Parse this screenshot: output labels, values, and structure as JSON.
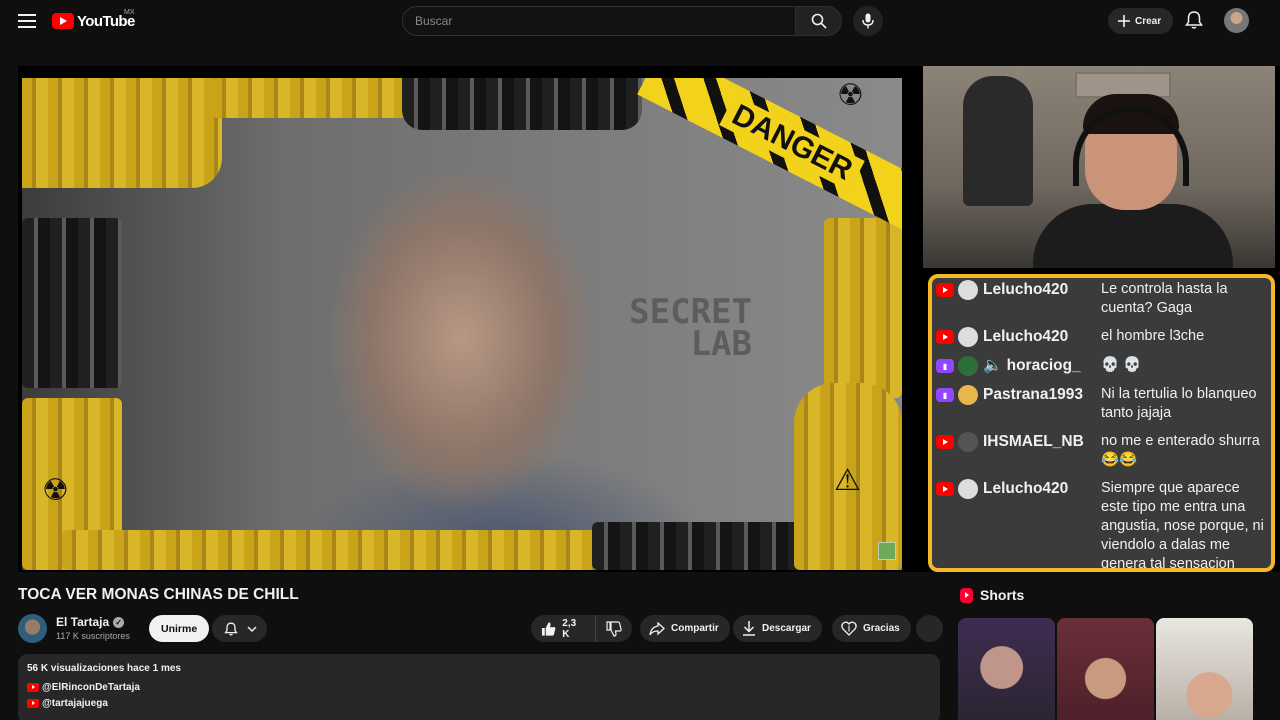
{
  "header": {
    "logo_text": "YouTube",
    "country": "MX",
    "search_placeholder": "Buscar",
    "create_label": "Crear"
  },
  "video": {
    "overlay_tape_text": "DANGER",
    "wall_text_line1": "SECRET",
    "wall_text_line2": "LAB",
    "title": "TOCA VER MONAS CHINAS DE CHILL"
  },
  "chat": {
    "messages": [
      {
        "platform": "youtube",
        "user": "Lelucho420",
        "text": "Le controla hasta la cuenta? Gaga"
      },
      {
        "platform": "youtube",
        "user": "Lelucho420",
        "text": "el hombre l3che"
      },
      {
        "platform": "twitch",
        "user": "🔈 horaciog_",
        "text": "💀 💀"
      },
      {
        "platform": "twitch",
        "user": "Pastrana1993",
        "text": "Ni la tertulia lo blanqueo tanto jajaja"
      },
      {
        "platform": "youtube",
        "user": "IHSMAEL_NB",
        "text": "no me e enterado shurra 😂😂"
      },
      {
        "platform": "youtube",
        "user": "Lelucho420",
        "text": "Siempre que aparece este tipo me entra una angustia, nose porque, ni viendolo a dalas me genera tal sensacion"
      }
    ]
  },
  "channel": {
    "name": "El Tartaja",
    "subscribers": "117 K suscriptores",
    "join_label": "Unirme"
  },
  "actions": {
    "likes": "2,3 K",
    "share_label": "Compartir",
    "download_label": "Descargar",
    "thanks_label": "Gracias"
  },
  "description": {
    "meta": "56 K visualizaciones  hace 1 mes",
    "links": [
      "@ElRinconDeTartaja",
      "@tartajajuega"
    ]
  },
  "shorts": {
    "heading": "Shorts"
  },
  "colors": {
    "background": "#0f0f0f",
    "brand_red": "#ff0000",
    "chat_border": "#f5b928",
    "twitch_purple": "#9146ff"
  }
}
